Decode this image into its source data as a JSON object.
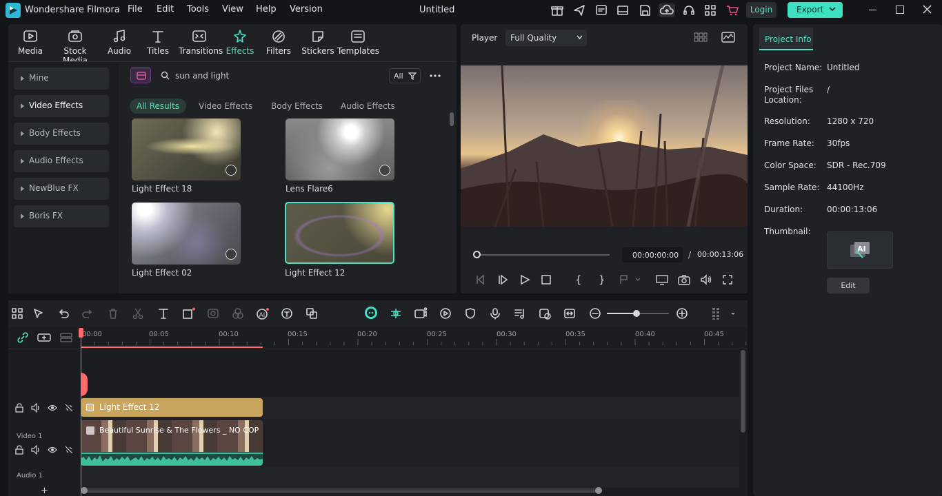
{
  "app": {
    "name": "Wondershare Filmora",
    "doc_title": "Untitled"
  },
  "menu": [
    "File",
    "Edit",
    "Tools",
    "View",
    "Help",
    "Version"
  ],
  "header": {
    "login": "Login",
    "export": "Export"
  },
  "toolbar": [
    "Media",
    "Stock Media",
    "Audio",
    "Titles",
    "Transitions",
    "Effects",
    "Filters",
    "Stickers",
    "Templates"
  ],
  "sidebar": [
    "Mine",
    "Video Effects",
    "Body Effects",
    "Audio Effects",
    "NewBlue FX",
    "Boris FX"
  ],
  "search": {
    "value": "sun and light",
    "filter": "All"
  },
  "filter_tabs": [
    "All Results",
    "Video Effects",
    "Body Effects",
    "Audio Effects"
  ],
  "effects": [
    {
      "label": "Light Effect 18"
    },
    {
      "label": "Lens Flare6"
    },
    {
      "label": "Light Effect 02"
    },
    {
      "label": "Light Effect 12"
    }
  ],
  "player": {
    "label": "Player",
    "quality": "Full Quality",
    "current": "00:00:00:00",
    "sep": "/",
    "total": "00:00:13:06"
  },
  "project_info": {
    "tab": "Project Info",
    "rows": [
      {
        "k": "Project Name:",
        "v": "Untitled"
      },
      {
        "k": "Project Files Location:",
        "v": "/"
      },
      {
        "k": "Resolution:",
        "v": "1280 x 720"
      },
      {
        "k": "Frame Rate:",
        "v": "30fps"
      },
      {
        "k": "Color Space:",
        "v": "SDR - Rec.709"
      },
      {
        "k": "Sample Rate:",
        "v": "44100Hz"
      },
      {
        "k": "Duration:",
        "v": "00:00:13:06"
      }
    ],
    "thumbnail_label": "Thumbnail:",
    "edit": "Edit"
  },
  "timeline": {
    "ticks": [
      "00:00",
      "00:05",
      "00:10",
      "00:15",
      "00:20",
      "00:25",
      "00:30",
      "00:35",
      "00:40",
      "00:45"
    ],
    "effect_clip": "Light Effect 12",
    "video_clip": "Beautiful Sunrise & The Flowers _ NO COP",
    "track_video": "Video 1",
    "track_audio": "Audio 1"
  }
}
